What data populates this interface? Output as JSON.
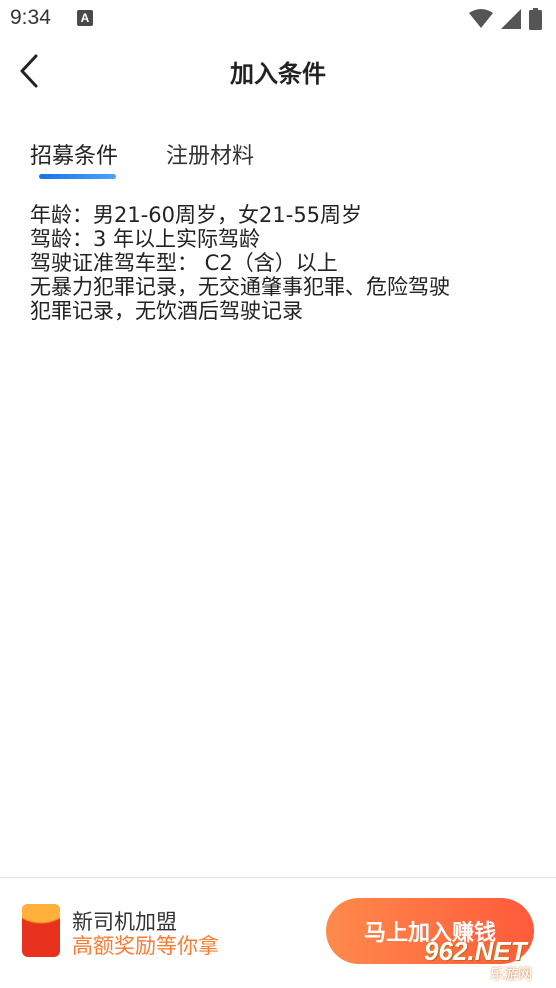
{
  "status_bar": {
    "time": "9:34",
    "notification_icon": "a-notification-icon",
    "icons": [
      "wifi-icon",
      "signal-icon",
      "battery-icon"
    ]
  },
  "header": {
    "title": "加入条件",
    "back_icon": "chevron-left-icon"
  },
  "tabs": [
    {
      "label": "招募条件",
      "active": true
    },
    {
      "label": "注册材料",
      "active": false
    }
  ],
  "content": {
    "lines": [
      "年龄：男21-60周岁，女21-55周岁",
      "驾龄：3 年以上实际驾龄",
      "驾驶证准驾车型： C2（含）以上",
      "无暴力犯罪记录，无交通肇事犯罪、危险驾驶",
      "犯罪记录，无饮酒后驾驶记录"
    ]
  },
  "footer": {
    "promo_title": "新司机加盟",
    "promo_subtitle": "高额奖励等你拿",
    "join_button": "马上加入赚钱"
  },
  "watermark": {
    "main": "962.NET",
    "sub": "乐游网"
  },
  "colors": {
    "accent_blue": "#1a73e8",
    "promo_orange": "#ff7a2e",
    "button_gradient_start": "#ff8a4c",
    "button_gradient_end": "#ff5a3a"
  }
}
